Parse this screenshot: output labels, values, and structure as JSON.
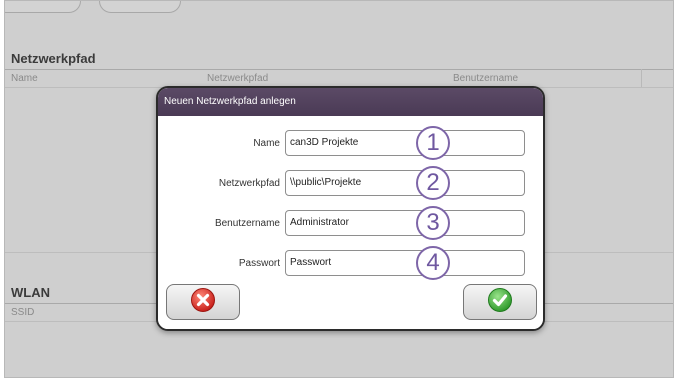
{
  "background": {
    "network_section_title": "Netzwerkpfad",
    "columns": [
      "Name",
      "Netzwerkpfad",
      "Benutzername"
    ],
    "wlan_section_title": "WLAN",
    "wlan_column": "SSID"
  },
  "dialog": {
    "title": "Neuen Netzwerkpfad anlegen",
    "fields": [
      {
        "label": "Name",
        "value": "can3D Projekte",
        "marker": "1"
      },
      {
        "label": "Netzwerkpfad",
        "value": "\\\\public\\Projekte",
        "marker": "2"
      },
      {
        "label": "Benutzername",
        "value": "Administrator",
        "marker": "3"
      },
      {
        "label": "Passwort",
        "value": "Passwort",
        "marker": "4"
      }
    ],
    "cancel_icon": "red-x-circle-icon",
    "confirm_icon": "green-check-circle-icon"
  },
  "colors": {
    "header": "#4f3f5c",
    "marker": "#7e66a8",
    "cancel": "#d9302a",
    "confirm": "#3aa639"
  }
}
